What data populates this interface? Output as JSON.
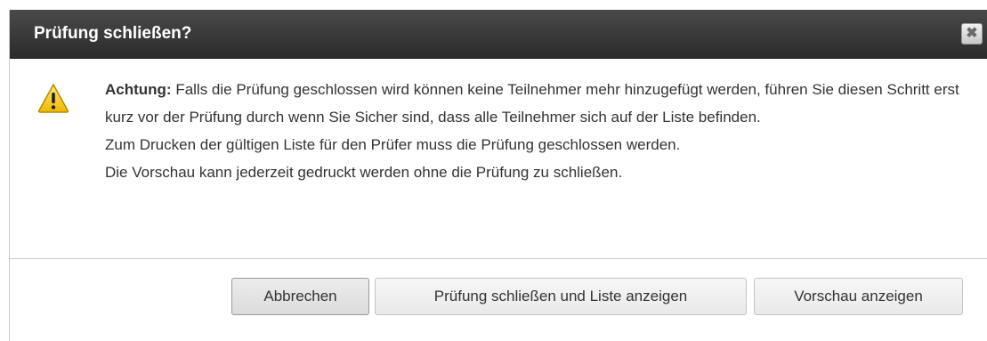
{
  "dialog": {
    "title": "Prüfung schließen?",
    "close_icon": "close-icon",
    "warning_icon": "warning-icon",
    "warning_label": "Achtung:",
    "warning_text": " Falls die Prüfung geschlossen wird können keine Teilnehmer mehr hinzugefügt werden, führen Sie diesen Schritt erst kurz vor der Prüfung durch wenn Sie Sicher sind, dass alle Teilnehmer sich auf der Liste befinden.",
    "line_print": "Zum Drucken der gültigen Liste für den Prüfer muss die Prüfung geschlossen werden.",
    "line_preview": "Die Vorschau kann jederzeit gedruckt werden ohne die Prüfung zu schließen."
  },
  "buttons": {
    "cancel": "Abbrechen",
    "close_and_list": "Prüfung schließen und Liste anzeigen",
    "preview": "Vorschau anzeigen"
  },
  "colors": {
    "titlebar": "#333333",
    "warning": "#f5c400"
  }
}
